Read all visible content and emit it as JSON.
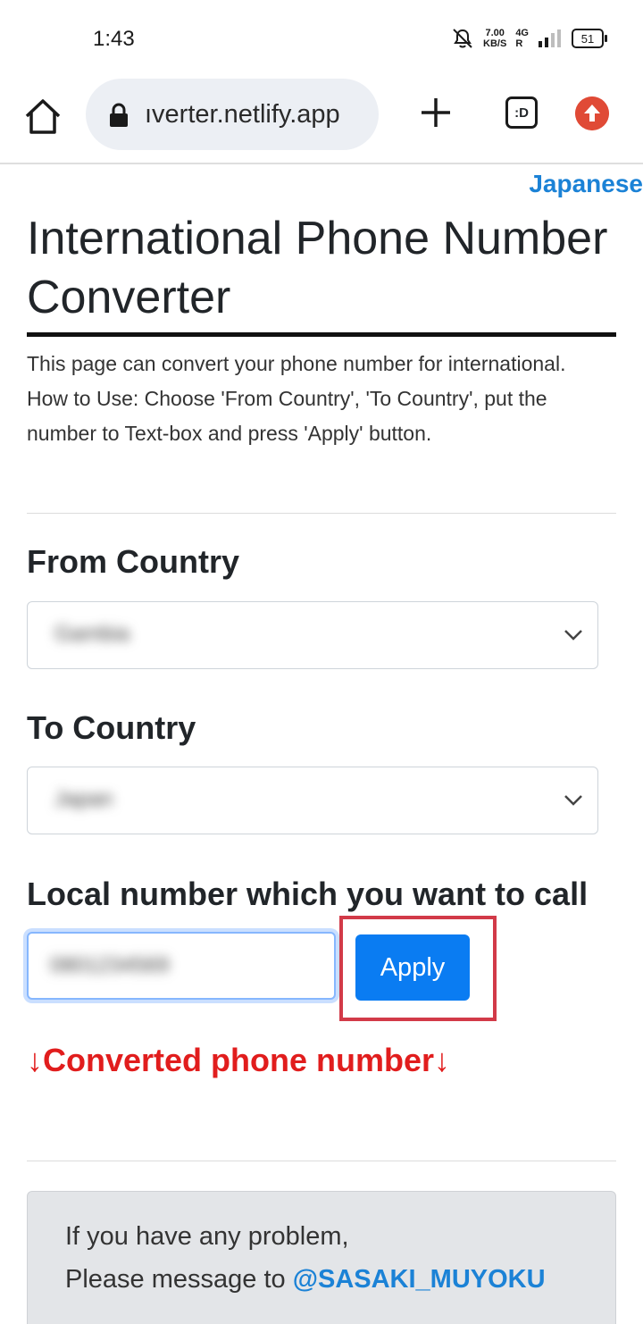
{
  "status_bar": {
    "time": "1:43",
    "net_speed_value": "7.00",
    "net_speed_unit": "KB/S",
    "network_type": "4G",
    "network_roaming": "R",
    "battery_level": "51",
    "icons": [
      "mute-bell-icon",
      "signal-bars-icon",
      "battery-icon"
    ]
  },
  "browser": {
    "url": "ıverter.netlify.app",
    "tab_label": ":D",
    "icons": [
      "home-icon",
      "lock-icon",
      "plus-icon",
      "tabs-icon",
      "update-icon"
    ]
  },
  "page": {
    "language_link": "Japanese",
    "title": "International Phone Number Converter",
    "description_line1": "This page can convert your phone number for international.",
    "description_line2": "How to Use: Choose 'From Country', 'To Country', put the number to Text-box and press 'Apply' button.",
    "from_country": {
      "label": "From Country",
      "value": "Gambia"
    },
    "to_country": {
      "label": "To Country",
      "value": "Japan"
    },
    "local_number": {
      "label": "Local number which you want to call",
      "value": "0801234569"
    },
    "apply_label": "Apply",
    "converted_label": "↓Converted phone number↓",
    "contact": {
      "line1": "If you have any problem,",
      "line2_prefix": "Please message to ",
      "handle": "@SASAKI_MUYOKU"
    }
  },
  "colors": {
    "link_blue": "#1b82d6",
    "apply_button": "#0a7cf2",
    "converted_red": "#e11d1d",
    "highlight_red": "#d23a48",
    "contact_bg": "#e3e5e8"
  }
}
